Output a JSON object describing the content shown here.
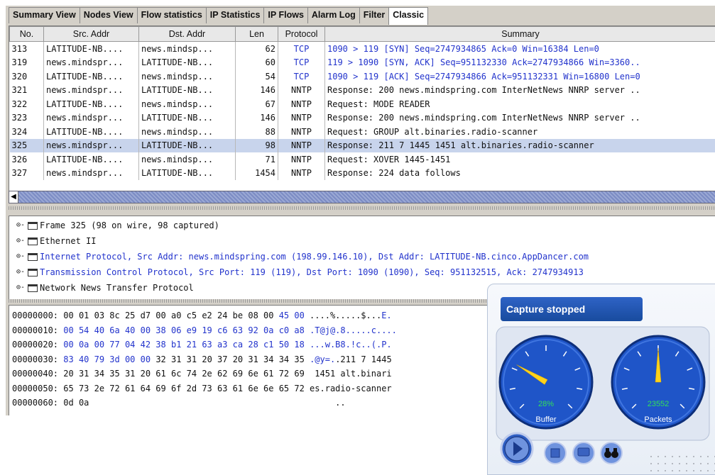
{
  "tabs": [
    "Summary View",
    "Nodes View",
    "Flow statistics",
    "IP Statistics",
    "IP Flows",
    "Alarm Log",
    "Filter",
    "Classic"
  ],
  "active_tab": "Classic",
  "table": {
    "columns": [
      "No.",
      "Src. Addr",
      "Dst. Addr",
      "Len",
      "Protocol",
      "Summary"
    ],
    "rows": [
      {
        "no": "313",
        "src": "LATITUDE-NB....",
        "dst": "news.mindsp...",
        "len": "62",
        "proto": "TCP",
        "summary": "1090 > 119 [SYN] Seq=2747934865 Ack=0 Win=16384 Len=0",
        "blue": true
      },
      {
        "no": "319",
        "src": "news.mindspr...",
        "dst": "LATITUDE-NB...",
        "len": "60",
        "proto": "TCP",
        "summary": "119 > 1090 [SYN, ACK] Seq=951132330 Ack=2747934866 Win=3360..",
        "blue": true
      },
      {
        "no": "320",
        "src": "LATITUDE-NB....",
        "dst": "news.mindsp...",
        "len": "54",
        "proto": "TCP",
        "summary": "1090 > 119 [ACK] Seq=2747934866 Ack=951132331 Win=16800 Len=0",
        "blue": true
      },
      {
        "no": "321",
        "src": "news.mindspr...",
        "dst": "LATITUDE-NB...",
        "len": "146",
        "proto": "NNTP",
        "summary": "Response: 200 news.mindspring.com InterNetNews NNRP server ..",
        "blue": false
      },
      {
        "no": "322",
        "src": "LATITUDE-NB....",
        "dst": "news.mindsp...",
        "len": "67",
        "proto": "NNTP",
        "summary": "Request: MODE READER",
        "blue": false
      },
      {
        "no": "323",
        "src": "news.mindspr...",
        "dst": "LATITUDE-NB...",
        "len": "146",
        "proto": "NNTP",
        "summary": "Response: 200 news.mindspring.com InterNetNews NNRP server ..",
        "blue": false
      },
      {
        "no": "324",
        "src": "LATITUDE-NB....",
        "dst": "news.mindsp...",
        "len": "88",
        "proto": "NNTP",
        "summary": "Request: GROUP alt.binaries.radio-scanner",
        "blue": false
      },
      {
        "no": "325",
        "src": "news.mindspr...",
        "dst": "LATITUDE-NB...",
        "len": "98",
        "proto": "NNTP",
        "summary": "Response: 211 7 1445 1451 alt.binaries.radio-scanner",
        "blue": false,
        "selected": true
      },
      {
        "no": "326",
        "src": "LATITUDE-NB....",
        "dst": "news.mindsp...",
        "len": "71",
        "proto": "NNTP",
        "summary": "Request: XOVER 1445-1451",
        "blue": false
      },
      {
        "no": "327",
        "src": "news.mindspr...",
        "dst": "LATITUDE-NB...",
        "len": "1454",
        "proto": "NNTP",
        "summary": "Response: 224 data follows",
        "blue": false
      }
    ]
  },
  "tree": [
    {
      "label": "Frame 325 (98 on wire, 98 captured)",
      "blue": false
    },
    {
      "label": "Ethernet II",
      "blue": false
    },
    {
      "label": "Internet Protocol, Src Addr: news.mindspring.com (198.99.146.10), Dst Addr: LATITUDE-NB.cinco.AppDancer.com",
      "blue": true
    },
    {
      "label": "Transmission Control Protocol, Src Port: 119 (119), Dst Port: 1090 (1090), Seq: 951132515, Ack: 2747934913",
      "blue": true
    },
    {
      "label": "Network News Transfer Protocol",
      "blue": false
    }
  ],
  "hex": [
    {
      "offset": "00000000:",
      "black": "00 01 03 8c 25 d7 00 a0 c5 e2 24 be 08 00 ",
      "blue": "45 00",
      "ascii_black": " ....%.....$...",
      "ascii_blue": "E."
    },
    {
      "offset": "00000010:",
      "black": "",
      "blue": "00 54 40 6a 40 00 38 06 e9 19 c6 63 92 0a c0 a8",
      "ascii_black": " ",
      "ascii_blue": ".T@j@.8.....c...."
    },
    {
      "offset": "00000020:",
      "black": "",
      "blue": "00 0a 00 77 04 42 38 b1 21 63 a3 ca 28 c1 50 18",
      "ascii_black": " ",
      "ascii_blue": "...w.B8.!c..(.P."
    },
    {
      "offset": "00000030:",
      "black": "",
      "blue": "83 40 79 3d 00 00",
      "black2": " 32 31 31 20 37 20 31 34 34 35",
      "ascii_blue_first": " .@y=.",
      "ascii_tail": ".211 7 1445"
    },
    {
      "offset": "00000040:",
      "black": "20 31 34 35 31 20 61 6c 74 2e 62 69 6e 61 72 69",
      "ascii_black": "  1451 alt.binari"
    },
    {
      "offset": "00000050:",
      "black": "65 73 2e 72 61 64 69 6f 2d 73 63 61 6e 6e 65 72",
      "ascii_black": " es.radio-scanner"
    },
    {
      "offset": "00000060:",
      "black": "0d 0a",
      "ascii_black": "                                                .."
    }
  ],
  "capture": {
    "status": "Capture stopped",
    "buffer_value": "28%",
    "buffer_label": "Buffer",
    "buffer_fraction": 0.28,
    "packets_value": "23552",
    "packets_label": "Packets",
    "packets_fraction": 0.5
  },
  "colors": {
    "accent_blue": "#2233cc",
    "selection": "#c8d4ec",
    "gauge_blue": "#1f55c8",
    "needle": "#ffd21a",
    "gauge_text": "#32e05a"
  }
}
